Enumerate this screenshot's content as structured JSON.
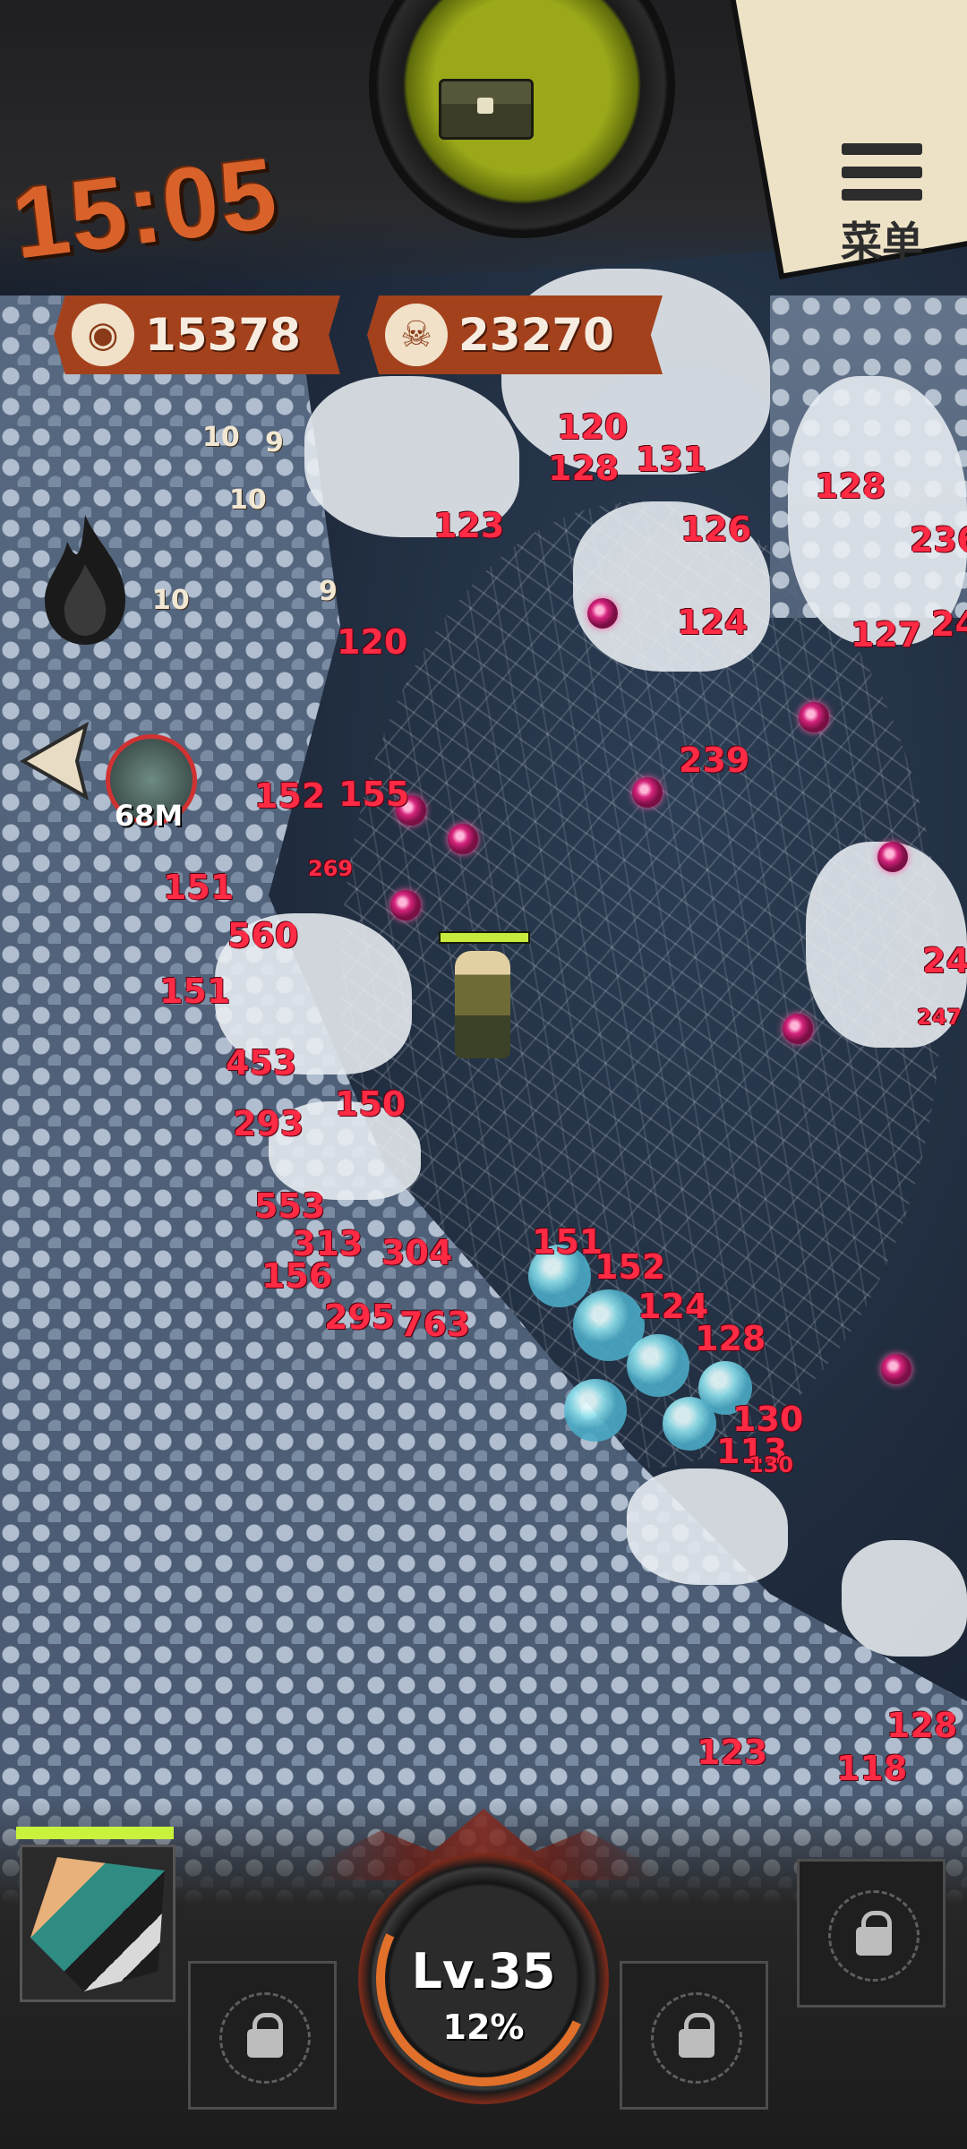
{
  "hud": {
    "timer": "15:05",
    "menu_label": "菜单",
    "coins": "15378",
    "kills": "23270",
    "boss_distance": "68M",
    "level": "Lv.35",
    "xp_percent": "12%"
  },
  "player": {
    "hp_fraction": 1.0
  },
  "hero": {
    "hp_fraction": 1.0
  },
  "damage_numbers": [
    {
      "text": "120"
    },
    {
      "text": "128"
    },
    {
      "text": "131"
    },
    {
      "text": "128"
    },
    {
      "text": "123"
    },
    {
      "text": "126"
    },
    {
      "text": "236"
    },
    {
      "text": "124"
    },
    {
      "text": "127"
    },
    {
      "text": "239"
    },
    {
      "text": "120"
    },
    {
      "text": "155"
    },
    {
      "text": "152"
    },
    {
      "text": "269"
    },
    {
      "text": "151"
    },
    {
      "text": "560"
    },
    {
      "text": "151"
    },
    {
      "text": "453"
    },
    {
      "text": "150"
    },
    {
      "text": "293"
    },
    {
      "text": "553"
    },
    {
      "text": "313"
    },
    {
      "text": "304"
    },
    {
      "text": "156"
    },
    {
      "text": "295"
    },
    {
      "text": "763"
    },
    {
      "text": "151"
    },
    {
      "text": "152"
    },
    {
      "text": "124"
    },
    {
      "text": "128"
    },
    {
      "text": "130"
    },
    {
      "text": "113"
    },
    {
      "text": "130"
    },
    {
      "text": "123"
    },
    {
      "text": "128"
    },
    {
      "text": "118"
    },
    {
      "text": "24"
    },
    {
      "text": "247"
    },
    {
      "text": "24"
    }
  ],
  "grey_numbers": [
    {
      "text": "10"
    },
    {
      "text": "9"
    },
    {
      "text": "10"
    },
    {
      "text": "10"
    },
    {
      "text": "9"
    }
  ],
  "colors": {
    "timer": "#d9622b",
    "counter_bg": "#a4411d",
    "damage": "#ff2a44",
    "hp": "#c6ea3e"
  }
}
